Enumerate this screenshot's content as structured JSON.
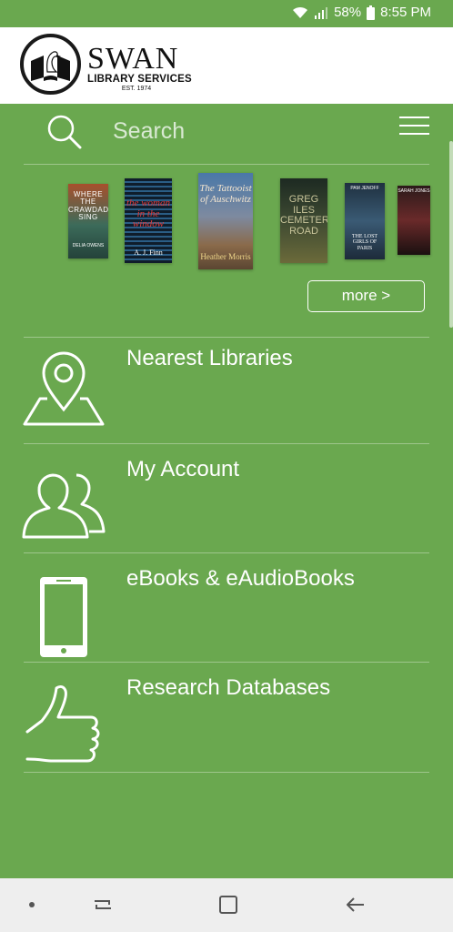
{
  "status_bar": {
    "battery": "58%",
    "time": "8:55 PM",
    "icons": [
      "wifi-icon",
      "signal-icon",
      "battery-icon"
    ]
  },
  "header": {
    "logo_title": "SWAN",
    "logo_subtitle": "LIBRARY SERVICES",
    "logo_est": "EST. 1974"
  },
  "search": {
    "placeholder": "Search"
  },
  "books": [
    {
      "title": "WHERE THE CRAWDADS SING",
      "author": "DELIA OWENS"
    },
    {
      "title": "the woman in the window",
      "author": "A. J. Finn"
    },
    {
      "title": "The Tattooist of Auschwitz",
      "author": "Heather Morris"
    },
    {
      "title": "GREG ILES CEMETERY ROAD"
    },
    {
      "title": "THE LOST GIRLS OF PARIS",
      "author": "PAM JENOFF"
    },
    {
      "title": "SARAH JONES"
    }
  ],
  "more_button": "more >",
  "menu": [
    {
      "label": "Nearest Libraries",
      "icon": "map-pin-icon"
    },
    {
      "label": "My Account",
      "icon": "users-icon"
    },
    {
      "label": "eBooks & eAudioBooks",
      "icon": "phone-icon"
    },
    {
      "label": "Research Databases",
      "icon": "thumbs-up-icon"
    }
  ],
  "colors": {
    "background": "#6aa84f",
    "header": "#ffffff",
    "nav_bar": "#eeeeee"
  }
}
